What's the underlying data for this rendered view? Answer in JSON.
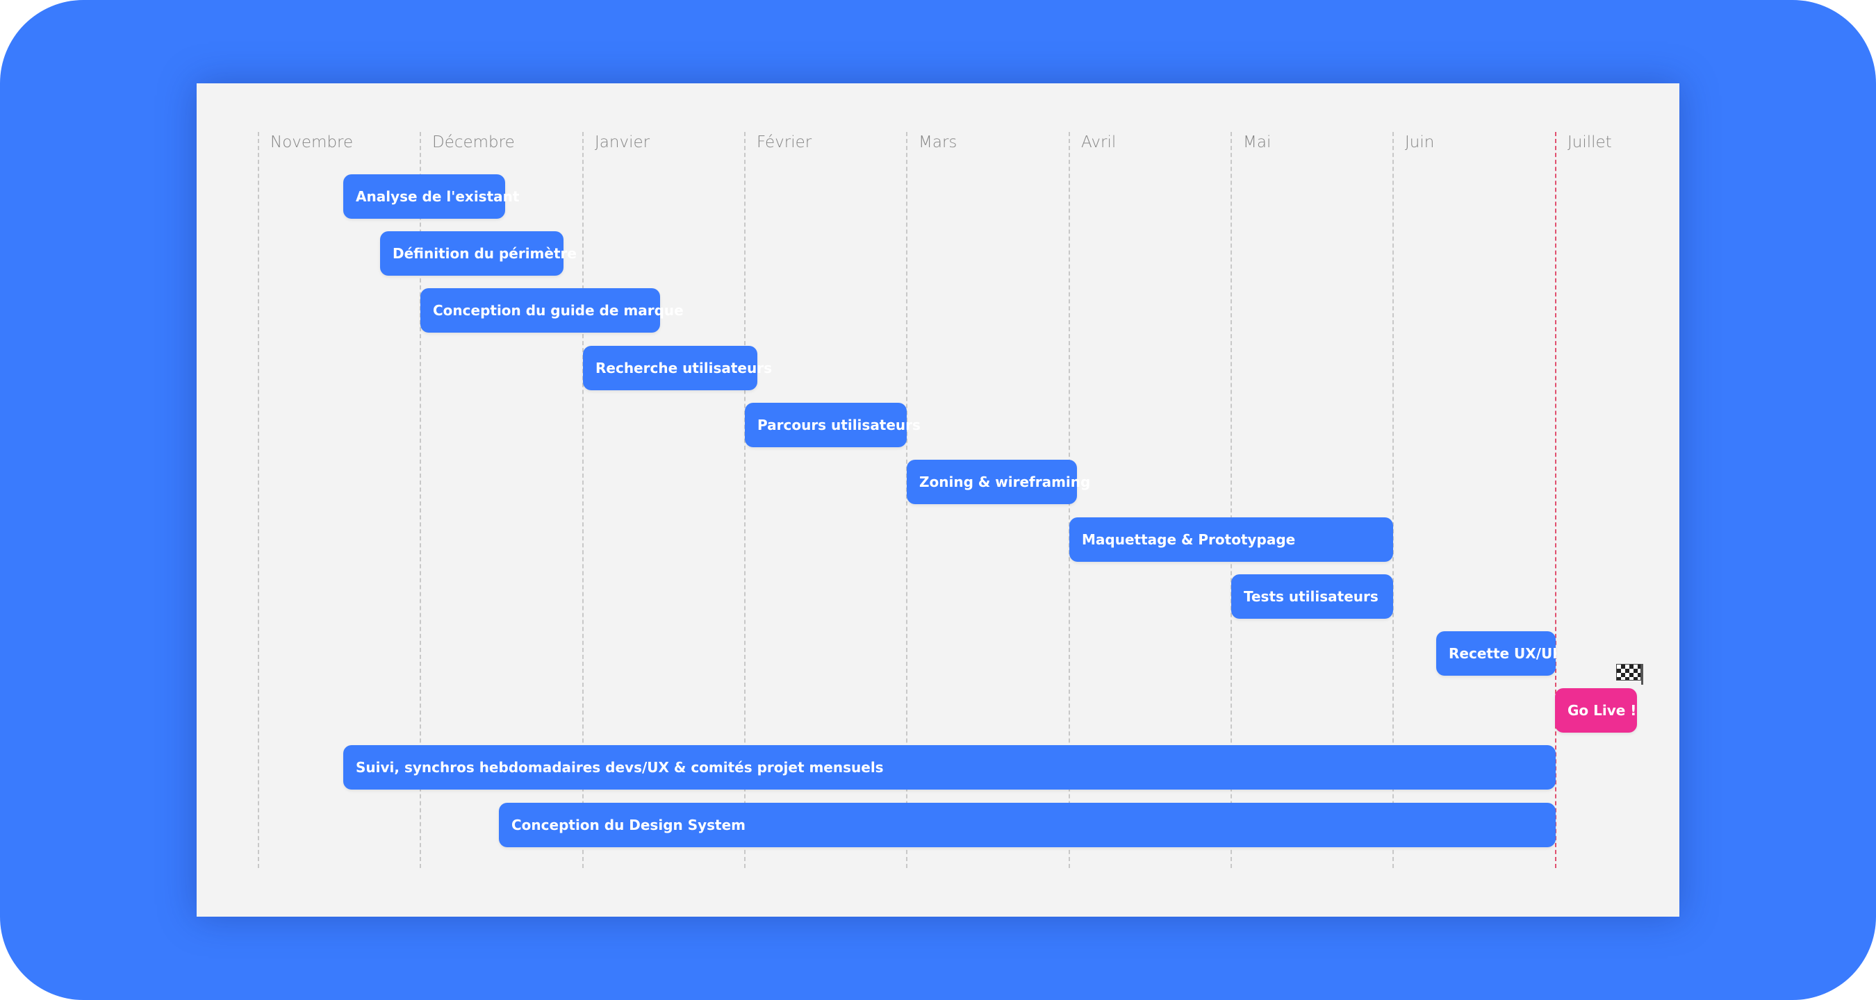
{
  "roadmap": {
    "months": [
      "Novembre",
      "Décembre",
      "Janvier",
      "Février",
      "Mars",
      "Avril",
      "Mai",
      "Juin",
      "Juillet"
    ],
    "tasks": [
      {
        "label": "Analyse de l'existant",
        "type": "task"
      },
      {
        "label": "Définition du périmètre",
        "type": "task"
      },
      {
        "label": "Conception du guide de marque",
        "type": "task"
      },
      {
        "label": "Recherche utilisateurs",
        "type": "task"
      },
      {
        "label": "Parcours utilisateurs",
        "type": "task"
      },
      {
        "label": "Zoning & wireframing",
        "type": "task"
      },
      {
        "label": "Maquettage & Prototypage",
        "type": "task"
      },
      {
        "label": "Tests utilisateurs",
        "type": "task"
      },
      {
        "label": "Recette UX/UI",
        "type": "task"
      },
      {
        "label": "Go Live !",
        "type": "milestone"
      },
      {
        "label": "Suivi, synchros hebdomadaires devs/UX & comités projet mensuels",
        "type": "task"
      },
      {
        "label": "Conception du Design System",
        "type": "task"
      }
    ],
    "colors": {
      "frame": "#3a7bfd",
      "board": "#f3f3f3",
      "task": "#3a7bfd",
      "milestone": "#ee2d92",
      "go_live_line": "#e0506e"
    },
    "milestone_icon": "checkered-flag-icon"
  }
}
